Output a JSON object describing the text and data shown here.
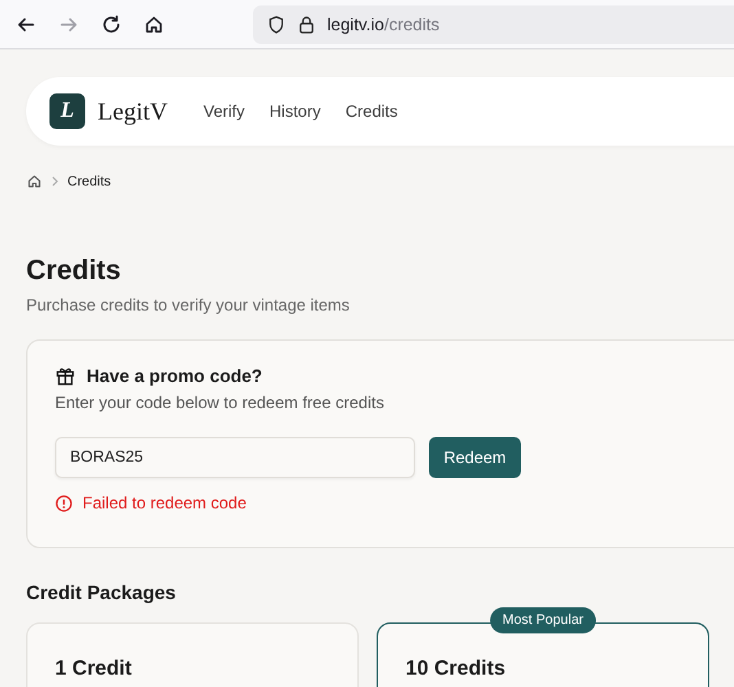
{
  "browser": {
    "buttons": [
      {
        "kind": "back",
        "disabled": false
      },
      {
        "kind": "forward",
        "disabled": true
      },
      {
        "kind": "reload",
        "disabled": false
      },
      {
        "kind": "home",
        "disabled": false
      }
    ],
    "url_host": "legitv.io",
    "url_path": "/credits"
  },
  "nav": {
    "logo_letter": "L",
    "brand": "LegitV",
    "links": [
      "Verify",
      "History",
      "Credits"
    ]
  },
  "breadcrumb": {
    "current": "Credits"
  },
  "page": {
    "title": "Credits",
    "subtitle": "Purchase credits to verify your vintage items"
  },
  "promo": {
    "title": "Have a promo code?",
    "description": "Enter your code below to redeem free credits",
    "value": "BORAS25",
    "button": "Redeem",
    "error": "Failed to redeem code"
  },
  "packages": {
    "title": "Credit Packages",
    "items": [
      {
        "name": "1 Credit",
        "highlighted": false
      },
      {
        "name": "10 Credits",
        "highlighted": true,
        "badge": "Most Popular"
      }
    ]
  }
}
